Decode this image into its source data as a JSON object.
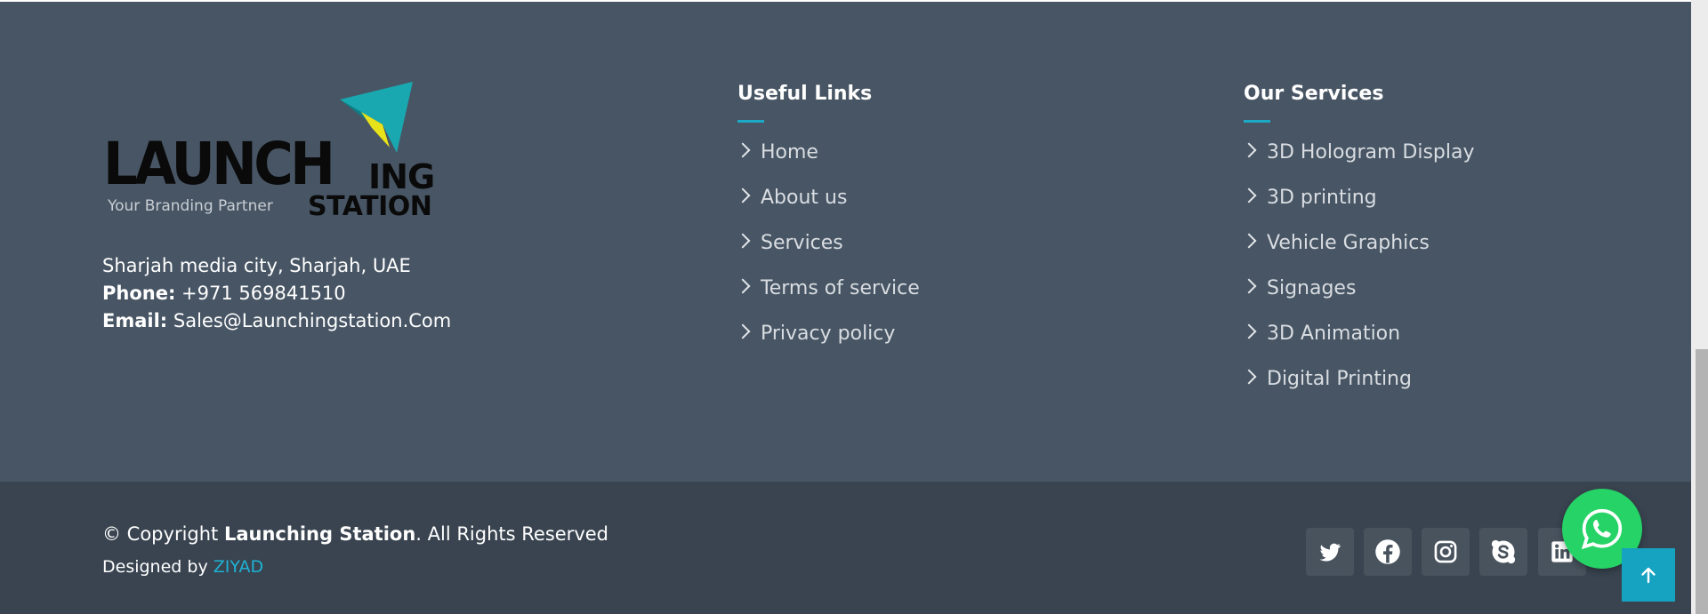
{
  "brand": {
    "logo_word": "LAUNCH",
    "logo_ing": "ING",
    "logo_station": "STATION",
    "tagline": "Your Branding Partner",
    "colors": {
      "mark_teal": "#1aa8b0",
      "mark_yellow": "#e8e21a"
    }
  },
  "contact": {
    "address": "Sharjah media city, Sharjah, UAE",
    "phone_label": "Phone:",
    "phone": "+971 569841510",
    "email_label": "Email:",
    "email": "Sales@Launchingstation.Com"
  },
  "useful_links": {
    "title": "Useful Links",
    "items": [
      "Home",
      "About us",
      "Services",
      "Terms of service",
      "Privacy policy"
    ]
  },
  "services": {
    "title": "Our Services",
    "items": [
      "3D Hologram Display",
      "3D printing",
      "Vehicle Graphics",
      "Signages",
      "3D Animation",
      "Digital Printing"
    ]
  },
  "footer": {
    "copyright_prefix": "© Copyright",
    "company": "Launching Station",
    "copyright_suffix": ". All Rights Reserved",
    "designed_prefix": "Designed by",
    "designer": "ZIYAD"
  },
  "social": [
    "twitter-icon",
    "facebook-icon",
    "instagram-icon",
    "skype-icon",
    "linkedin-icon"
  ],
  "colors": {
    "footer_top": "#475564",
    "footer_bottom": "#394450",
    "accent": "#1ba9c6",
    "whatsapp": "#25d366",
    "back_to_top": "#16a2c1"
  }
}
